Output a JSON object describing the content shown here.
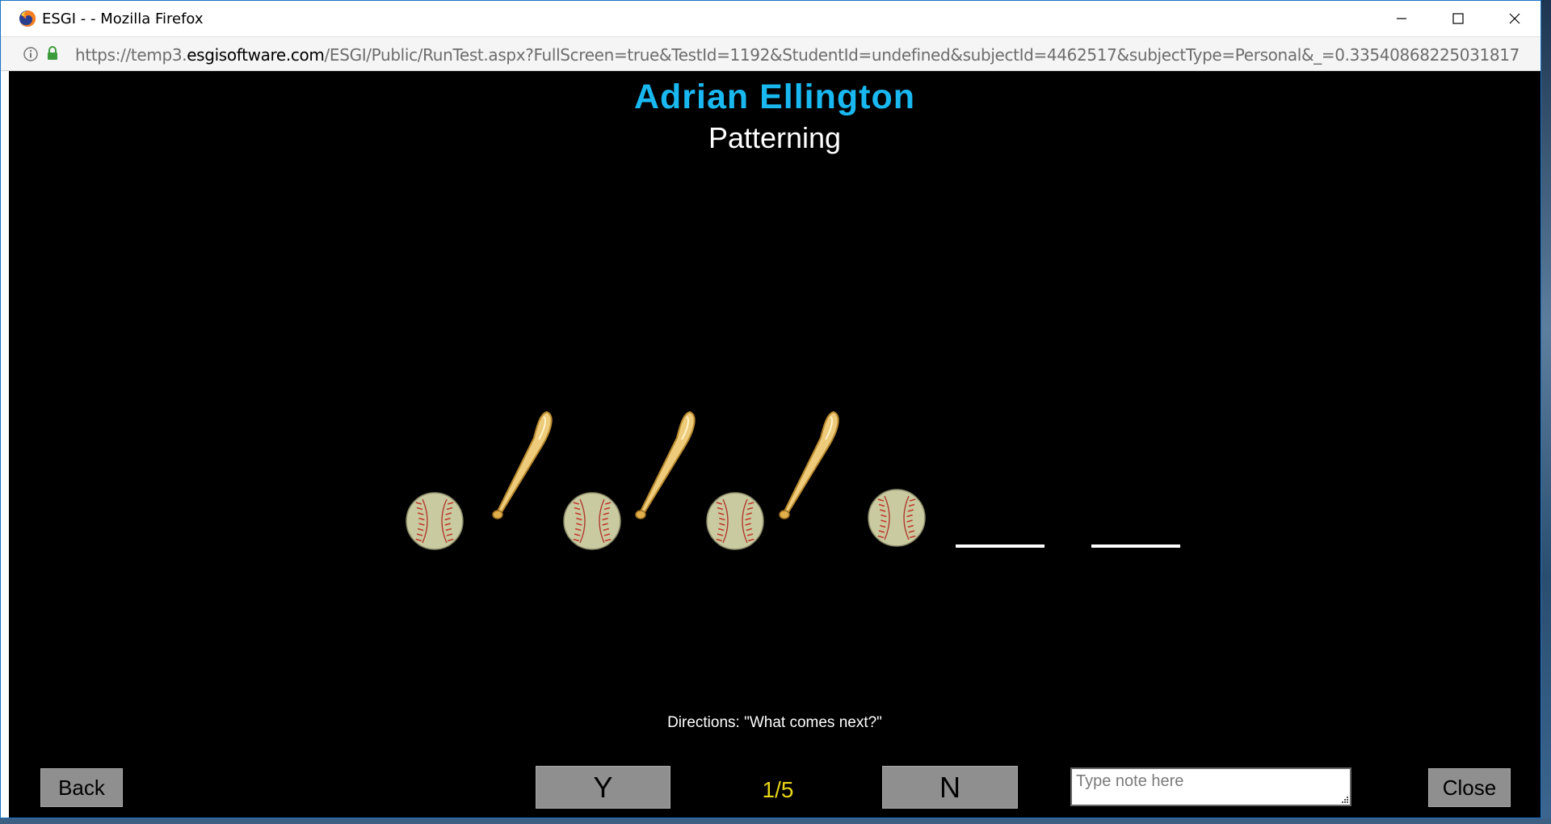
{
  "window": {
    "title": "ESGI - - Mozilla Firefox",
    "icons": [
      "firefox-icon",
      "minimize-icon",
      "maximize-icon",
      "close-icon"
    ]
  },
  "address_bar": {
    "url_prefix": "https://temp3.",
    "url_domain": "esgisoftware.com",
    "url_path": "/ESGI/Public/RunTest.aspx?FullScreen=true&TestId=1192&StudentId=undefined&subjectId=4462517&subjectType=Personal&_=0.33540868225031817",
    "icons": [
      "info-icon",
      "lock-icon"
    ]
  },
  "test": {
    "student_name": "Adrian Ellington",
    "test_name": "Patterning",
    "pattern_items": [
      "baseball",
      "bat",
      "baseball",
      "bat",
      "baseball",
      "bat",
      "baseball",
      "blank",
      "blank"
    ],
    "directions": "Directions: \"What comes next?\"",
    "progress_text": "1/5",
    "progress": {
      "current": 1,
      "total": 5
    }
  },
  "controls": {
    "back_label": "Back",
    "yes_label": "Y",
    "no_label": "N",
    "close_label": "Close",
    "note_placeholder": "Type note here"
  },
  "colors": {
    "student_name": "#19b8f0",
    "progress_text": "#e8d619",
    "button_bg": "#8f8f8f",
    "stage_bg": "#000000"
  }
}
